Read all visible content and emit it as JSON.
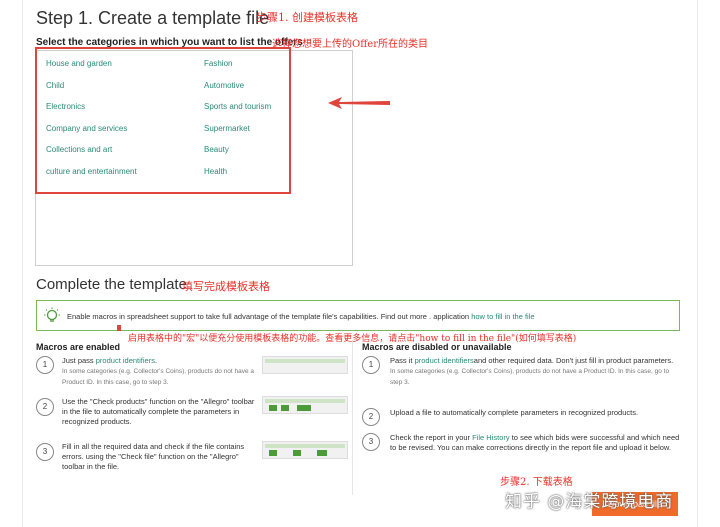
{
  "step1": {
    "title": "Step 1. Create a template file",
    "annotation": "步骤1. 创建模板表格",
    "subtitle": "Select the categories in which you want to list the offers",
    "subtitle_annotation": "选择您想要上传的Offer所在的类目",
    "categories_left": [
      "House and garden",
      "Child",
      "Electronics",
      "Company and services",
      "Collections and art",
      "culture and entertainment"
    ],
    "categories_right": [
      "Fashion",
      "Automotive",
      "Sports and tourism",
      "Supermarket",
      "Beauty",
      "Health"
    ]
  },
  "complete": {
    "title": "Complete the template",
    "annotation": "填写完成模板表格",
    "tip_text": "Enable macros in spreadsheet support to take full advantage of the template file's capabilities. Find out more . application",
    "tip_link": "how to fill in the file",
    "tip_annotation": "启用表格中的\"宏\"以便充分使用模板表格的功能。查看更多信息，请点击\"how to fill in the file\"(如何填写表格)"
  },
  "macros_enabled": {
    "title": "Macros are enabled",
    "steps": [
      {
        "n": "1",
        "pre": "Just pass ",
        "link": "product identifiers",
        "post": ".",
        "note": "In some categories (e.g. Collector's Coins), products do not have a Product ID. In this case, go to step 3."
      },
      {
        "n": "2",
        "text": "Use the \"Check products\" function on the \"Allegro\" toolbar in the file to automatically complete the parameters in recognized products."
      },
      {
        "n": "3",
        "text": "Fill in all the required data and check if the file contains errors. using the \"Check file\" function on the \"Allegro\" toolbar in the file."
      }
    ]
  },
  "macros_disabled": {
    "title": "Macros are disabled or unavailable",
    "steps": [
      {
        "n": "1",
        "pre": "Pass it ",
        "link": "product identifiers",
        "post": "and other required data. Don't just fill in product parameters.",
        "note": "In some categories (e.g. Collector's Coins), products do not have a Product ID. In this case, go to step 3."
      },
      {
        "n": "2",
        "text": "Upload a file to automatically complete parameters in recognized products."
      },
      {
        "n": "3",
        "pre": "Check the report in your ",
        "link": "File History",
        "post": " to see which bids were successful and which need to be revised. You can make corrections directly in the report file and upload it below."
      }
    ]
  },
  "step2_annotation": "步骤2. 下载表格",
  "download_button": "Download file",
  "watermark": "知乎 @海棠跨境电商",
  "colors": {
    "accent": "#2a8a78",
    "annotation": "#e8302a",
    "button": "#f06a2a",
    "tip_border": "#7ab85a"
  },
  "icons": {
    "tip": "lightbulb-icon",
    "arrow": "red-arrow-icon"
  }
}
